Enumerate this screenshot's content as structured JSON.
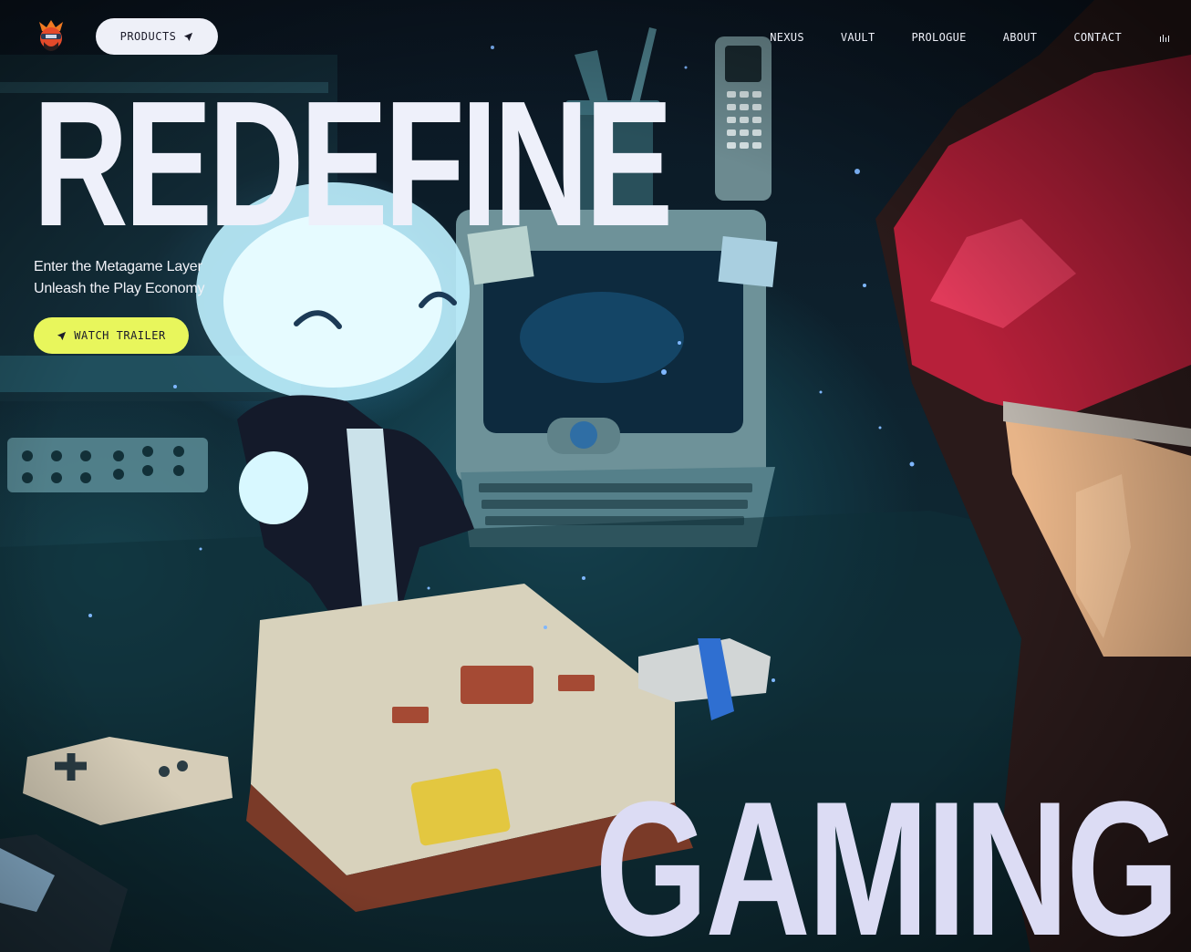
{
  "nav": {
    "logo_icon": "ninja-avatar-logo",
    "products_label": "PRODUCTS",
    "links": [
      "NEXUS",
      "VAULT",
      "PROLOGUE",
      "ABOUT",
      "CONTACT"
    ],
    "audio_icon": "audio-bars-icon"
  },
  "hero": {
    "headline": "REDEFINE",
    "subtitle_line1": "Enter the Metagame Layer",
    "subtitle_line2": "Unleash the Play Economy",
    "cta_label": "WATCH TRAILER",
    "bottom_word": "GAMING",
    "background": "retro-gaming-room-illustration"
  },
  "colors": {
    "headline": "#eef0fa",
    "accent_button": "#e8f65c",
    "pill_button": "#eef0f8",
    "bottom_word": "#dcdcf4"
  }
}
